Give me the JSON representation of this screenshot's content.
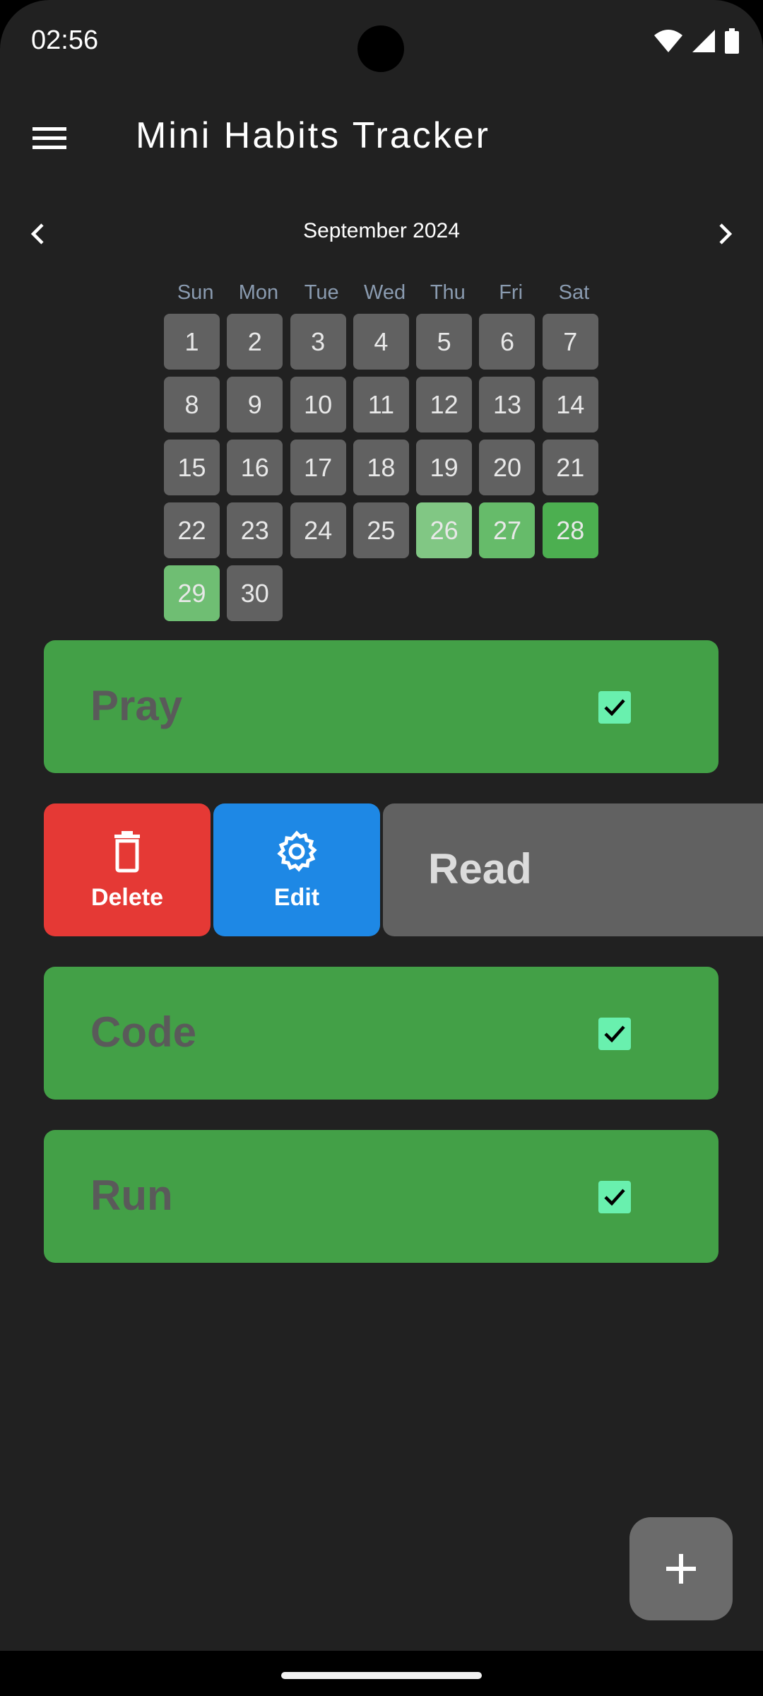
{
  "status_bar": {
    "time": "02:56",
    "icons": [
      "wifi-icon",
      "signal-icon",
      "battery-icon"
    ]
  },
  "app_bar": {
    "title": "Mini Habits Tracker",
    "menu_icon": "menu-icon"
  },
  "calendar": {
    "month_label": "September 2024",
    "weekdays": [
      "Sun",
      "Mon",
      "Tue",
      "Wed",
      "Thu",
      "Fri",
      "Sat"
    ],
    "days": [
      "1",
      "2",
      "3",
      "4",
      "5",
      "6",
      "7",
      "8",
      "9",
      "10",
      "11",
      "12",
      "13",
      "14",
      "15",
      "16",
      "17",
      "18",
      "19",
      "20",
      "21",
      "22",
      "23",
      "24",
      "25",
      "26",
      "27",
      "28",
      "29",
      "30"
    ],
    "completed_day_shades": {
      "26": "#81c784",
      "27": "#66bb6a",
      "28": "#4caf50",
      "29": "#6fbe73"
    },
    "default_day_color": "#616161"
  },
  "habits": [
    {
      "name": "Pray",
      "checked": true
    },
    {
      "name": "Read",
      "checked": false
    },
    {
      "name": "Code",
      "checked": true
    },
    {
      "name": "Run",
      "checked": true
    }
  ],
  "swipe_actions": {
    "delete_label": "Delete",
    "edit_label": "Edit"
  },
  "fab": {
    "icon": "plus-icon"
  },
  "colors": {
    "background": "#212121",
    "habit_done": "#43a047",
    "habit_pending": "#616161",
    "delete": "#e53935",
    "edit": "#1e88e5",
    "checkbox": "#69f0ae"
  }
}
